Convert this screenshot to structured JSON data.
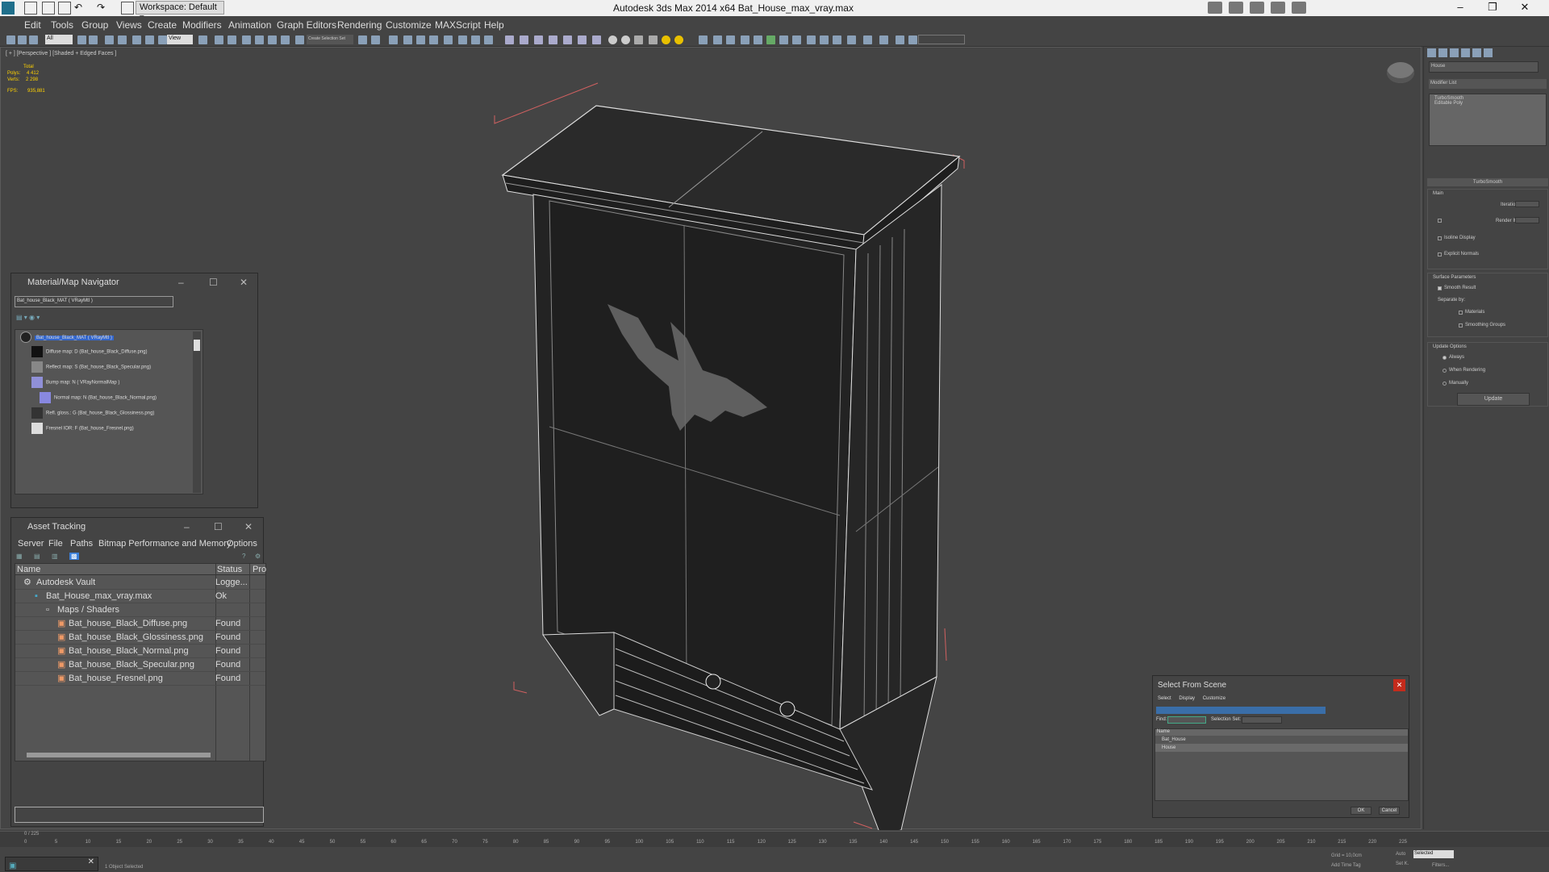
{
  "titlebar": {
    "workspace_label": "Workspace: Default",
    "title": "Autodesk 3ds Max  2014 x64    Bat_House_max_vray.max"
  },
  "menu": [
    "Edit",
    "Tools",
    "Group",
    "Views",
    "Create",
    "Modifiers",
    "Animation",
    "Graph Editors",
    "Rendering",
    "Customize",
    "MAXScript",
    "Help"
  ],
  "toolbar": {
    "selection_filter": "All",
    "ref_coord": "View",
    "named_selection": "Create Selection Set"
  },
  "viewport": {
    "label": "[ + ] [Perspective ] [Shaded + Edged Faces ]",
    "stats_header": "Total",
    "stats_polys_label": "Polys:",
    "stats_polys": "4 412",
    "stats_verts_label": "Verts:",
    "stats_verts": "2 298",
    "fps_label": "FPS:",
    "fps": "935,881"
  },
  "command_panel": {
    "object_name": "House",
    "modifier_list": "Modifier List",
    "stack_items": [
      "TurboSmooth",
      "Editable Poly"
    ],
    "turbosmooth": {
      "title": "TurboSmooth",
      "main": "Main",
      "iterations_label": "Iterations:",
      "render_iters_label": "Render Iters:",
      "isoline": "Isoline Display",
      "explicit_normals": "Explicit Normals",
      "surface_params": "Surface Parameters",
      "smooth_result": "Smooth Result",
      "separate_by": "Separate by:",
      "materials": "Materials",
      "smoothing_groups": "Smoothing Groups",
      "update_options": "Update Options",
      "always": "Always",
      "when_rendering": "When Rendering",
      "manually": "Manually",
      "update_button": "Update"
    }
  },
  "material_navigator": {
    "title": "Material/Map Navigator",
    "field": "Bat_house_Black_MAT ( VRayMtl )",
    "rows": [
      "Bat_house_Black_MAT  ( VRayMtl )",
      "Diffuse map: D (Bat_house_Black_Diffuse.png)",
      "Reflect map: S (Bat_house_Black_Specular.png)",
      "Bump map: N  ( VRayNormalMap )",
      "Normal map: N (Bat_house_Black_Normal.png)",
      "Refl. gloss.: G (Bat_house_Black_Glossiness.png)",
      "Fresnel IOR: F (Bat_house_Fresnel.png)"
    ]
  },
  "asset_tracking": {
    "title": "Asset Tracking",
    "menu": [
      "Server",
      "File",
      "Paths",
      "Bitmap Performance and Memory",
      "Options"
    ],
    "columns": [
      "Name",
      "Status",
      "Pro"
    ],
    "rows": [
      {
        "name": "Autodesk Vault",
        "status": "Logge..."
      },
      {
        "name": "Bat_House_max_vray.max",
        "status": "Ok"
      },
      {
        "name": "Maps / Shaders",
        "status": ""
      },
      {
        "name": "Bat_house_Black_Diffuse.png",
        "status": "Found"
      },
      {
        "name": "Bat_house_Black_Glossiness.png",
        "status": "Found"
      },
      {
        "name": "Bat_house_Black_Normal.png",
        "status": "Found"
      },
      {
        "name": "Bat_house_Black_Specular.png",
        "status": "Found"
      },
      {
        "name": "Bat_house_Fresnel.png",
        "status": "Found"
      }
    ]
  },
  "select_from_scene": {
    "title": "Select From Scene",
    "menu": [
      "Select",
      "Display",
      "Customize"
    ],
    "find_label": "Find:",
    "selection_set_label": "Selection Set:",
    "column": "Name",
    "items": [
      "Bat_House",
      "House"
    ],
    "ok": "OK",
    "cancel": "Cancel"
  },
  "timeline": {
    "frame": "0 / 225",
    "ticks": [
      "0",
      "5",
      "10",
      "15",
      "20",
      "25",
      "30",
      "35",
      "40",
      "45",
      "50",
      "55",
      "60",
      "65",
      "70",
      "75",
      "80",
      "85",
      "90",
      "95",
      "100",
      "105",
      "110",
      "115",
      "120",
      "125",
      "130",
      "135",
      "140",
      "145",
      "150",
      "155",
      "160",
      "165",
      "170",
      "175",
      "180",
      "185",
      "190",
      "195",
      "200",
      "205",
      "210",
      "215",
      "220",
      "225"
    ]
  },
  "status": {
    "objects": "1 Object Selected",
    "grid": "Grid = 10,0cm",
    "auto": "Auto",
    "selected": "Selected",
    "set_key": "Set K.",
    "filters": "Filters...",
    "add_time_tag": "Add Time Tag"
  }
}
